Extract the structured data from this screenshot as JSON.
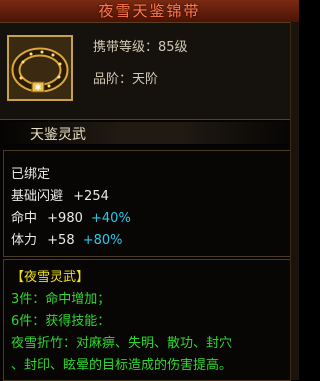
{
  "title": "夜雪天鉴锦带",
  "item": {
    "icon": "golden-belt-icon",
    "level_label": "携带等级：85级",
    "rank_label": "品阶：天阶"
  },
  "subtitle": "天鉴灵武",
  "stats": {
    "bound": "已绑定",
    "dodge": {
      "label": "基础闪避",
      "value": "+254"
    },
    "hit": {
      "label": "命中",
      "value": "+980",
      "bonus": "+40%"
    },
    "stamina": {
      "label": "体力",
      "value": "+58",
      "bonus": "+80%"
    }
  },
  "set": {
    "name": "【夜雪灵武】",
    "piece3": {
      "count": "3件：",
      "effect": "命中增加；"
    },
    "piece6": {
      "count": "6件：",
      "effect": "获得技能："
    },
    "skill_line1": "夜雪折竹：对麻痹、失明、散功、封穴",
    "skill_line2": "、封印、眩晕的目标造成的伤害提高。"
  },
  "colors": {
    "title": "#ff7a4a",
    "stat_bonus": "#28c9e8",
    "set_name": "#f0e020",
    "set_effect": "#2fd82f",
    "frame": "#c8a24a"
  }
}
